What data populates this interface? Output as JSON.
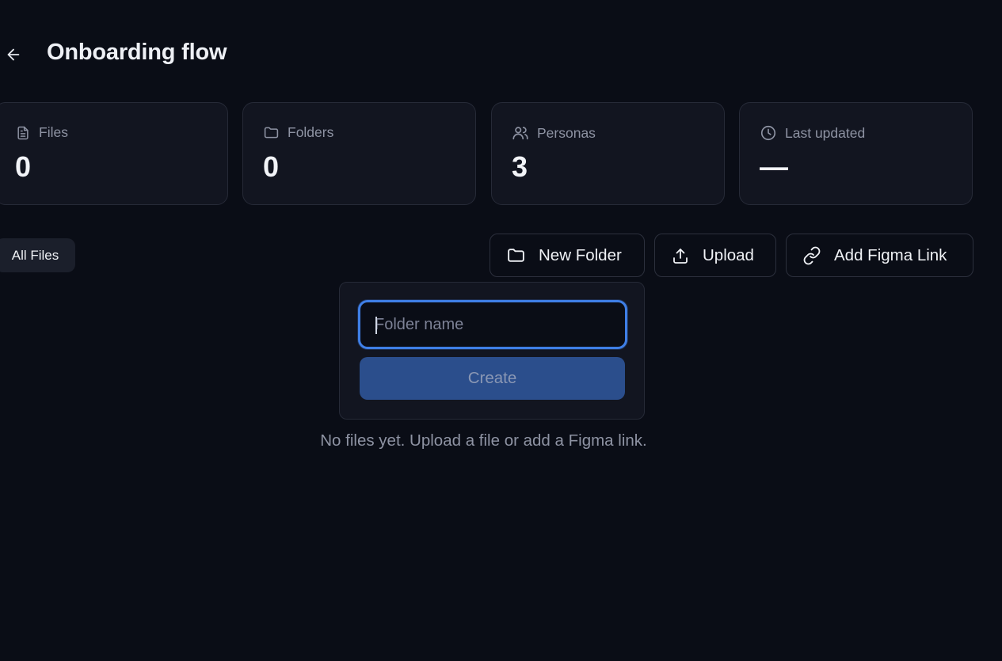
{
  "header": {
    "title": "Onboarding flow",
    "back_icon": "arrow-left-icon"
  },
  "stats": [
    {
      "label": "Files",
      "value": "0",
      "icon": "file-icon"
    },
    {
      "label": "Folders",
      "value": "0",
      "icon": "folder-icon"
    },
    {
      "label": "Personas",
      "value": "3",
      "icon": "users-icon"
    },
    {
      "label": "Last updated",
      "value": "—",
      "icon": "clock-icon"
    }
  ],
  "filters": {
    "all_files_label": "All Files"
  },
  "toolbar": {
    "new_folder_label": "New Folder",
    "upload_label": "Upload",
    "add_figma_label": "Add Figma Link"
  },
  "new_folder_popover": {
    "input_value": "",
    "placeholder": "Folder name",
    "create_label": "Create",
    "accent_color": "#3f7fe6"
  },
  "empty_state": {
    "message": "No files yet. Upload a file or add a Figma link."
  }
}
